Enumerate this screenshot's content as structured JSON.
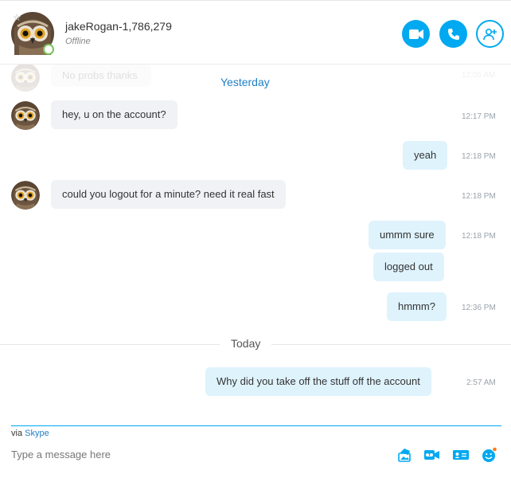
{
  "header": {
    "contact_name": "jakeRogan-1,786,279",
    "status": "Offline"
  },
  "ghost_message": {
    "text": "No probs thanks",
    "time": "12:05 AM"
  },
  "days": {
    "yesterday": "Yesterday",
    "today": "Today"
  },
  "messages": [
    {
      "text": "hey, u on the account?",
      "time": "12:17 PM",
      "direction": "incoming"
    },
    {
      "text": "yeah",
      "time": "12:18 PM",
      "direction": "outgoing"
    },
    {
      "text": "could you logout for a minute? need it real fast",
      "time": "12:18 PM",
      "direction": "incoming"
    },
    {
      "text": "ummm sure",
      "time": "12:18 PM",
      "direction": "outgoing"
    },
    {
      "text": "logged out",
      "time": "",
      "direction": "outgoing"
    },
    {
      "text": "hmmm?",
      "time": "12:36 PM",
      "direction": "outgoing"
    },
    {
      "text": "Why did you take off the stuff off the account",
      "time": "2:57 AM",
      "direction": "outgoing"
    }
  ],
  "composer": {
    "via_prefix": "via",
    "via_link": "Skype",
    "placeholder": "Type a message here"
  },
  "icons": {
    "video_call": "video-camera-icon",
    "audio_call": "phone-icon",
    "add_people": "add-person-icon",
    "send_image": "image-icon",
    "video_message": "video-message-icon",
    "send_contact": "contact-card-icon",
    "emoticons": "smiley-icon"
  },
  "colors": {
    "accent": "#00a9f0",
    "link": "#1e7fc6",
    "incoming_bubble": "#f0f2f5",
    "outgoing_bubble": "#dff3fd",
    "online_ring": "#7ac35a",
    "emoji_dot": "#f47b20"
  }
}
